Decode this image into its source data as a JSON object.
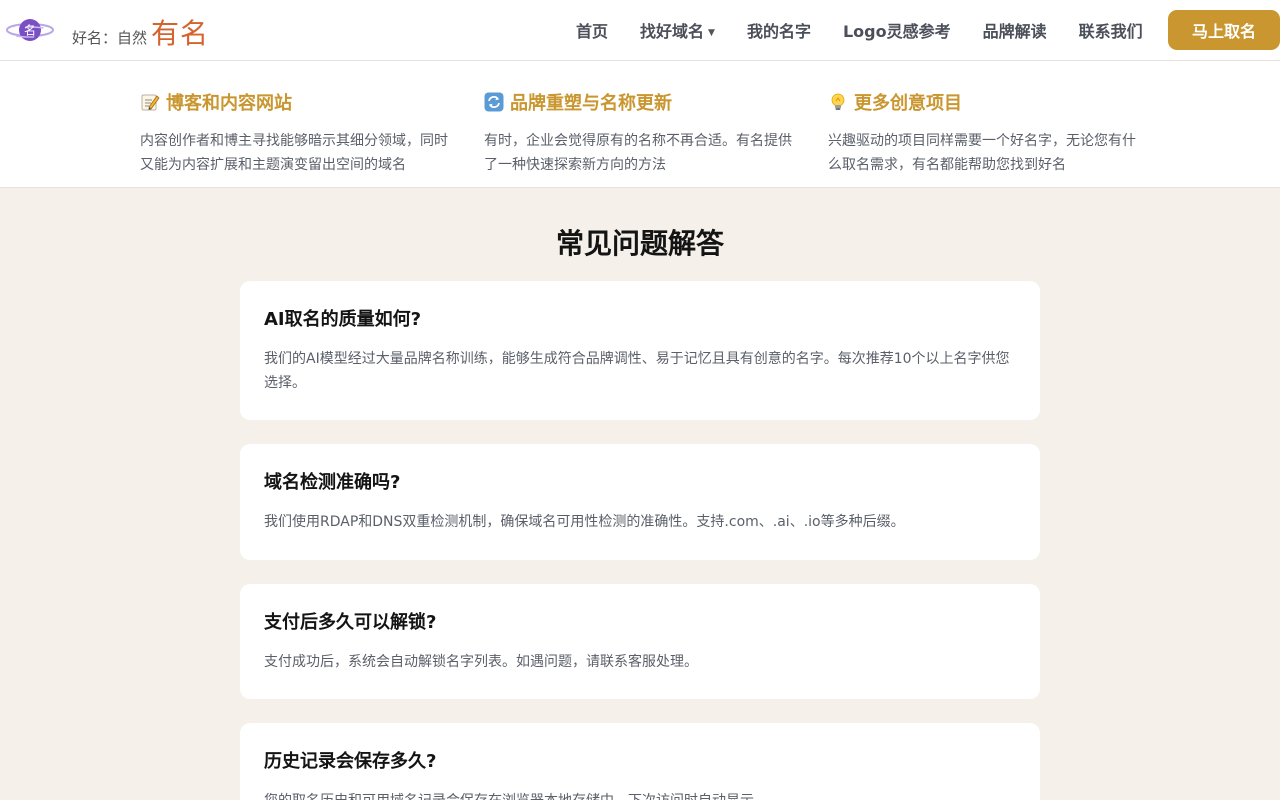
{
  "header": {
    "brand_prefix": "好名：自然",
    "brand_name": "有名",
    "logo_char": "名",
    "nav": [
      {
        "label": "首页"
      },
      {
        "label": "找好域名",
        "has_dropdown": true
      },
      {
        "label": "我的名字"
      },
      {
        "label": "Logo灵感参考"
      },
      {
        "label": "品牌解读"
      },
      {
        "label": "联系我们"
      }
    ],
    "cta_label": "马上取名"
  },
  "usecases": [
    {
      "icon": "memo-pencil-icon",
      "title": "博客和内容网站",
      "desc": "内容创作者和博主寻找能够暗示其细分领域，同时又能为内容扩展和主题演变留出空间的域名"
    },
    {
      "icon": "refresh-arrows-icon",
      "title": "品牌重塑与名称更新",
      "desc": "有时，企业会觉得原有的名称不再合适。有名提供了一种快速探索新方向的方法"
    },
    {
      "icon": "lightbulb-icon",
      "title": "更多创意项目",
      "desc": "兴趣驱动的项目同样需要一个好名字，无论您有什么取名需求，有名都能帮助您找到好名"
    }
  ],
  "faq": {
    "title": "常见问题解答",
    "items": [
      {
        "q": "AI取名的质量如何?",
        "a": "我们的AI模型经过大量品牌名称训练，能够生成符合品牌调性、易于记忆且具有创意的名字。每次推荐10个以上名字供您选择。"
      },
      {
        "q": "域名检测准确吗?",
        "a": "我们使用RDAP和DNS双重检测机制，确保域名可用性检测的准确性。支持.com、.ai、.io等多种后缀。"
      },
      {
        "q": "支付后多久可以解锁?",
        "a": "支付成功后，系统会自动解锁名字列表。如遇问题，请联系客服处理。"
      },
      {
        "q": "历史记录会保存多久?",
        "a": "您的取名历史和可用域名记录会保存在浏览器本地存储中，下次访问时自动显示。"
      }
    ]
  },
  "colors": {
    "accent": "#c9962f",
    "brand_name": "#d5632e",
    "page_bg": "#f5f0ea",
    "logo_purple": "#7b4fc4"
  }
}
